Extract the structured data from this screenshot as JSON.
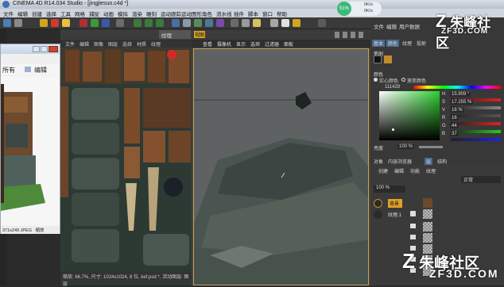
{
  "titlebar": {
    "title": "CINEMA 4D R14.034 Studio - [jingjiesuo.c4d *]"
  },
  "menubar": {
    "items": [
      "文件",
      "编辑",
      "创建",
      "选择",
      "工具",
      "网格",
      "捕捉",
      "动画",
      "模拟",
      "渲染",
      "雕刻",
      "运动跟踪",
      "运动图形",
      "角色",
      "流水线",
      "插件",
      "脚本",
      "窗口",
      "帮助"
    ]
  },
  "status_widget": {
    "percent": "51%",
    "upload": "0K/s",
    "download": "0K/s"
  },
  "texture_panel": {
    "tab": "纹理",
    "menu": [
      "文件",
      "编辑",
      "图像",
      "图层",
      "选择",
      "材质",
      "纹理"
    ],
    "status": "缩放: 66.7%, 尺寸: 1024x1024, 8 位, kef.psd *, 活动图层: 图层"
  },
  "viewport": {
    "tab": "视图",
    "menu": [
      "查看",
      "摄像机",
      "显示",
      "选项",
      "过滤器",
      "面板"
    ]
  },
  "photo_viewer": {
    "left_text": "所有",
    "edit_label": "编辑",
    "status": "371x249 JPEG",
    "status2": "缩放"
  },
  "right_panel": {
    "tabs_top": [
      "文件",
      "编辑",
      "用户数据"
    ],
    "mode_tabs": [
      "基本",
      "颜色",
      "纹理",
      "投射"
    ],
    "brush_label": "笔刷",
    "color_label": "颜色",
    "mode_options": [
      "实心颜色",
      "渐变颜色"
    ],
    "hex_value": "111429",
    "sliders": [
      {
        "label": "H",
        "value": "15.909 °",
        "color": "#d22"
      },
      {
        "label": "S",
        "value": "17.255 %",
        "color": "#888"
      },
      {
        "label": "V",
        "value": "16 %",
        "color": "#555"
      },
      {
        "label": "R",
        "value": "16",
        "color": "#d22"
      },
      {
        "label": "G",
        "value": "44",
        "color": "#2c2"
      },
      {
        "label": "B",
        "value": "37",
        "color": "#22d"
      }
    ],
    "brightness_label": "亮度",
    "brightness_value": "100 %",
    "layer_tabs": [
      "对象",
      "内容浏览器",
      "层",
      "结构"
    ],
    "layer_menu": [
      "创建",
      "编辑",
      "功能",
      "纹理"
    ],
    "blend_mode": "正常",
    "opacity": "100 %",
    "layers": [
      {
        "name": "背景"
      },
      {
        "name": "纹理.1"
      }
    ]
  },
  "watermarks": {
    "top": "朱峰社区",
    "top_url": "ZF3D.COM",
    "bottom": "朱峰社区",
    "bottom_url": "ZF3D.COM"
  }
}
